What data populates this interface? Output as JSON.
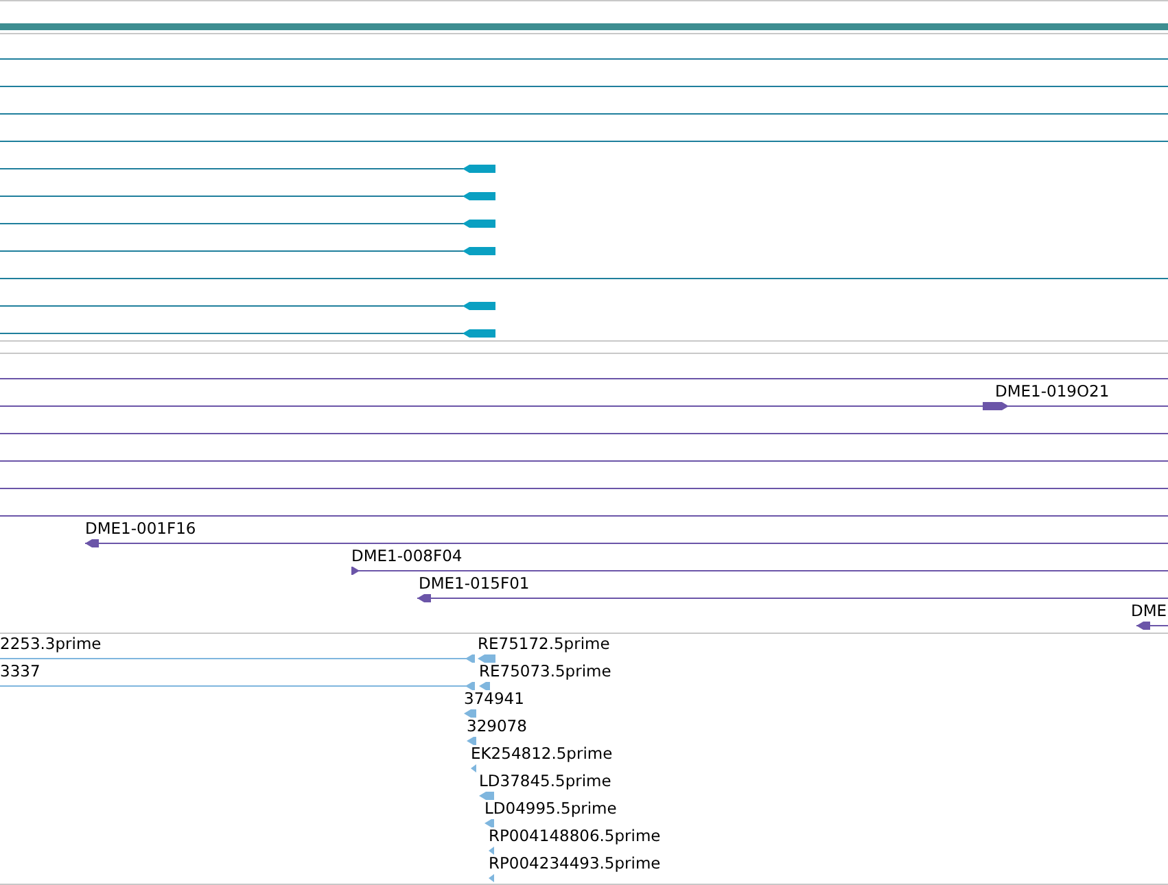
{
  "tracks": [
    {
      "kind": "transcripts",
      "features": [
        {
          "kind": "line"
        },
        {
          "kind": "line"
        },
        {
          "kind": "line"
        },
        {
          "kind": "line"
        },
        {
          "kind": "exon",
          "reverse": true
        },
        {
          "kind": "exon",
          "reverse": true
        },
        {
          "kind": "exon",
          "reverse": true
        },
        {
          "kind": "exon",
          "reverse": true
        },
        {
          "kind": "line"
        },
        {
          "kind": "exon",
          "reverse": true
        },
        {
          "kind": "exon",
          "reverse": true
        }
      ]
    },
    {
      "kind": "clones",
      "rows": [
        {
          "features": [
            {
              "kind": "line"
            }
          ]
        },
        {
          "features": [
            {
              "kind": "arrow",
              "label": "DME1-019O21",
              "reverse": false
            }
          ]
        },
        {
          "features": [
            {
              "kind": "line"
            }
          ]
        },
        {
          "features": [
            {
              "kind": "line"
            }
          ]
        },
        {
          "features": [
            {
              "kind": "line"
            }
          ]
        },
        {
          "features": [
            {
              "kind": "line"
            }
          ]
        },
        {
          "features": [
            {
              "kind": "arrow",
              "label": "DME1-001F16",
              "reverse": true
            }
          ]
        },
        {
          "features": [
            {
              "kind": "arrow",
              "label": "DME1-008F04",
              "reverse": false
            }
          ]
        },
        {
          "features": [
            {
              "kind": "arrow",
              "label": "DME1-015F01",
              "reverse": true
            }
          ]
        },
        {
          "features": [
            {
              "kind": "arrow",
              "label": "DME",
              "reverse": true
            }
          ]
        }
      ]
    },
    {
      "kind": "ests",
      "rows": [
        {
          "features": [
            {
              "kind": "arrow",
              "label": "2253.3prime",
              "reverse": true
            },
            {
              "kind": "arrow",
              "label": "RE75172.5prime",
              "reverse": true
            }
          ]
        },
        {
          "features": [
            {
              "kind": "arrow",
              "label": "3337",
              "reverse": true
            },
            {
              "kind": "arrow",
              "label": "RE75073.5prime",
              "reverse": true
            }
          ]
        },
        {
          "features": [
            {
              "kind": "arrow",
              "label": "374941",
              "reverse": true
            }
          ]
        },
        {
          "features": [
            {
              "kind": "arrow",
              "label": "329078",
              "reverse": true
            }
          ]
        },
        {
          "features": [
            {
              "kind": "arrow",
              "label": "EK254812.5prime",
              "reverse": true
            }
          ]
        },
        {
          "features": [
            {
              "kind": "arrow",
              "label": "LD37845.5prime",
              "reverse": true
            }
          ]
        },
        {
          "features": [
            {
              "kind": "arrow",
              "label": "LD04995.5prime",
              "reverse": true
            }
          ]
        },
        {
          "features": [
            {
              "kind": "arrow",
              "label": "RP004148806.5prime",
              "reverse": true
            }
          ]
        },
        {
          "features": [
            {
              "kind": "arrow",
              "label": "RP004234493.5prime",
              "reverse": true
            }
          ]
        }
      ]
    }
  ]
}
